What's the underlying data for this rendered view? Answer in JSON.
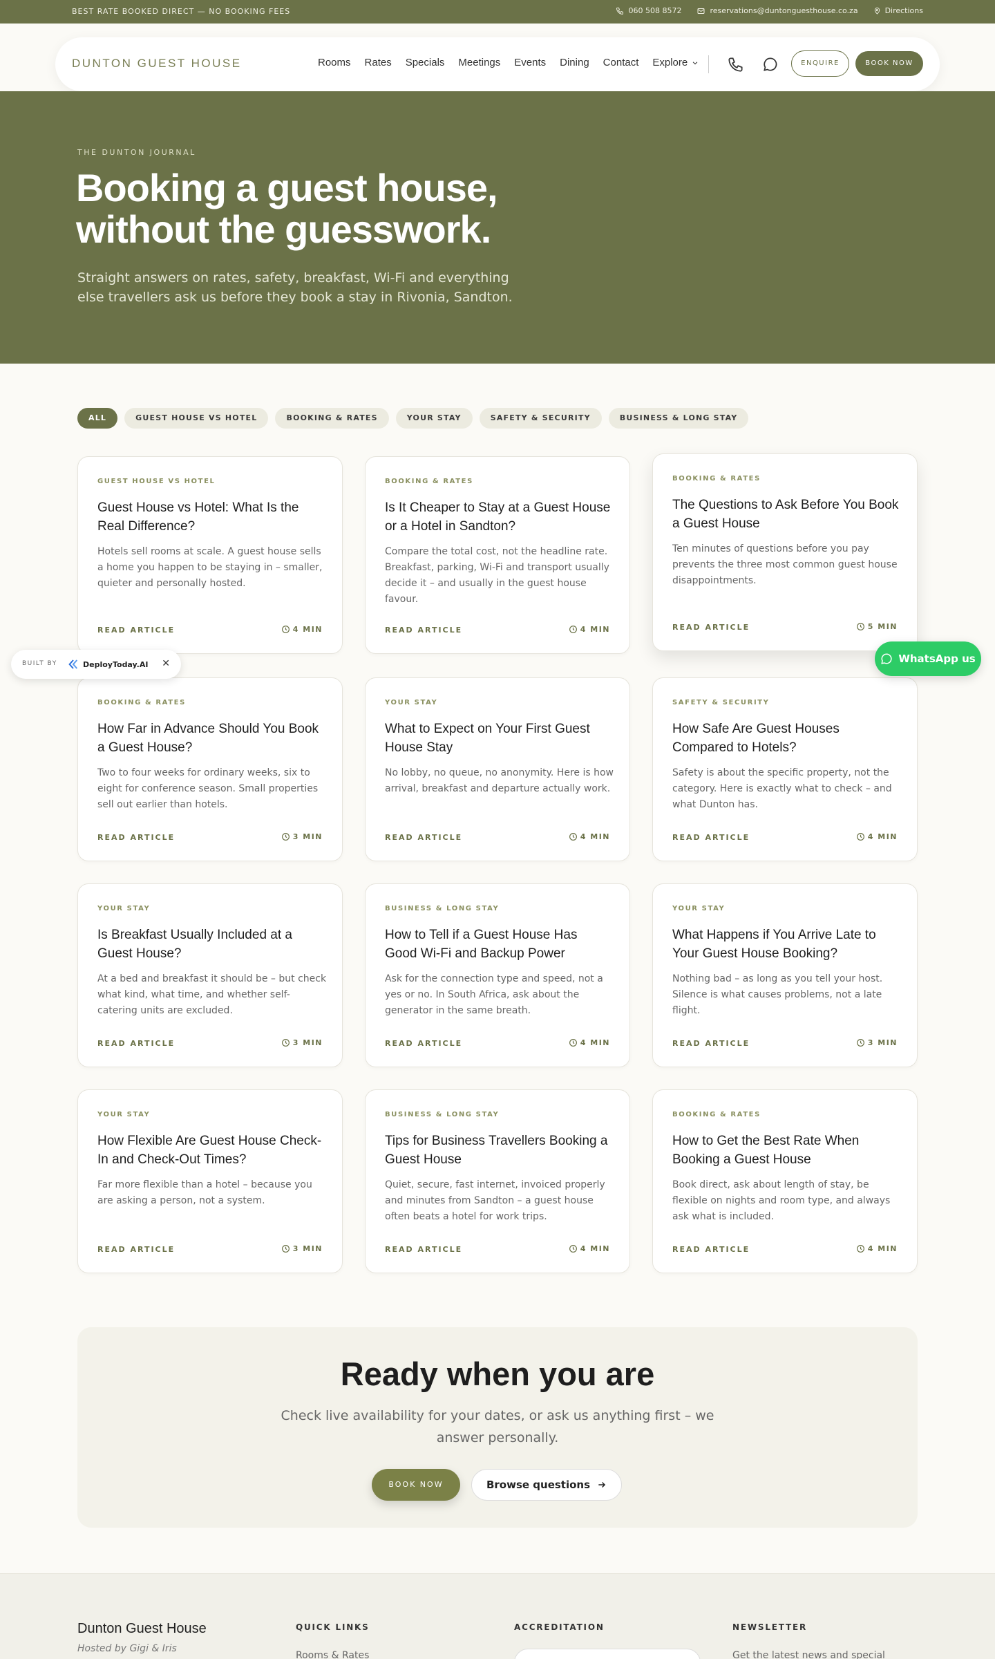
{
  "topbar": {
    "promo": "BEST RATE BOOKED DIRECT — NO BOOKING FEES",
    "phone": "060 508 8572",
    "email": "reservations@duntonguesthouse.co.za",
    "directions": "Directions"
  },
  "nav": {
    "logo": "DUNTON GUEST HOUSE",
    "items": [
      "Rooms",
      "Rates",
      "Specials",
      "Meetings",
      "Events",
      "Dining",
      "Contact",
      "Explore"
    ],
    "enquire": "ENQUIRE",
    "book": "BOOK NOW"
  },
  "hero": {
    "eyebrow": "THE DUNTON JOURNAL",
    "title": "Booking a guest house, without the guesswork.",
    "subtitle": "Straight answers on rates, safety, breakfast, Wi-Fi and everything else travellers ask us before they book a stay in Rivonia, Sandton."
  },
  "filters": [
    "ALL",
    "GUEST HOUSE VS HOTEL",
    "BOOKING & RATES",
    "YOUR STAY",
    "SAFETY & SECURITY",
    "BUSINESS & LONG STAY"
  ],
  "cards": [
    {
      "cat": "GUEST HOUSE VS HOTEL",
      "title": "Guest House vs Hotel: What Is the Real Difference?",
      "excerpt": "Hotels sell rooms at scale. A guest house sells a home you happen to be staying in – smaller, quieter and personally hosted.",
      "read": "READ ARTICLE",
      "time": "4 MIN"
    },
    {
      "cat": "BOOKING & RATES",
      "title": "Is It Cheaper to Stay at a Guest House or a Hotel in Sandton?",
      "excerpt": "Compare the total cost, not the headline rate. Breakfast, parking, Wi-Fi and transport usually decide it – and usually in the guest house favour.",
      "read": "READ ARTICLE",
      "time": "4 MIN"
    },
    {
      "cat": "BOOKING & RATES",
      "title": "The Questions to Ask Before You Book a Guest House",
      "excerpt": "Ten minutes of questions before you pay prevents the three most common guest house disappointments.",
      "read": "READ ARTICLE",
      "time": "5 MIN"
    },
    {
      "cat": "BOOKING & RATES",
      "title": "How Far in Advance Should You Book a Guest House?",
      "excerpt": "Two to four weeks for ordinary weeks, six to eight for conference season. Small properties sell out earlier than hotels.",
      "read": "READ ARTICLE",
      "time": "3 MIN"
    },
    {
      "cat": "YOUR STAY",
      "title": "What to Expect on Your First Guest House Stay",
      "excerpt": "No lobby, no queue, no anonymity. Here is how arrival, breakfast and departure actually work.",
      "read": "READ ARTICLE",
      "time": "4 MIN"
    },
    {
      "cat": "SAFETY & SECURITY",
      "title": "How Safe Are Guest Houses Compared to Hotels?",
      "excerpt": "Safety is about the specific property, not the category. Here is exactly what to check – and what Dunton has.",
      "read": "READ ARTICLE",
      "time": "4 MIN"
    },
    {
      "cat": "YOUR STAY",
      "title": "Is Breakfast Usually Included at a Guest House?",
      "excerpt": "At a bed and breakfast it should be – but check what kind, what time, and whether self-catering units are excluded.",
      "read": "READ ARTICLE",
      "time": "3 MIN"
    },
    {
      "cat": "BUSINESS & LONG STAY",
      "title": "How to Tell if a Guest House Has Good Wi-Fi and Backup Power",
      "excerpt": "Ask for the connection type and speed, not a yes or no. In South Africa, ask about the generator in the same breath.",
      "read": "READ ARTICLE",
      "time": "4 MIN"
    },
    {
      "cat": "YOUR STAY",
      "title": "What Happens if You Arrive Late to Your Guest House Booking?",
      "excerpt": "Nothing bad – as long as you tell your host. Silence is what causes problems, not a late flight.",
      "read": "READ ARTICLE",
      "time": "3 MIN"
    },
    {
      "cat": "YOUR STAY",
      "title": "How Flexible Are Guest House Check-In and Check-Out Times?",
      "excerpt": "Far more flexible than a hotel – because you are asking a person, not a system.",
      "read": "READ ARTICLE",
      "time": "3 MIN"
    },
    {
      "cat": "BUSINESS & LONG STAY",
      "title": "Tips for Business Travellers Booking a Guest House",
      "excerpt": "Quiet, secure, fast internet, invoiced properly and minutes from Sandton – a guest house often beats a hotel for work trips.",
      "read": "READ ARTICLE",
      "time": "4 MIN"
    },
    {
      "cat": "BOOKING & RATES",
      "title": "How to Get the Best Rate When Booking a Guest House",
      "excerpt": "Book direct, ask about length of stay, be flexible on nights and room type, and always ask what is included.",
      "read": "READ ARTICLE",
      "time": "4 MIN"
    }
  ],
  "badge": {
    "built_by": "BUILT BY",
    "brand": "DeployToday.AI",
    "close": "✕"
  },
  "whatsapp": "WhatsApp us",
  "cta": {
    "title": "Ready when you are",
    "text": "Check live availability for your dates, or ask us anything first – we answer personally.",
    "book": "BOOK NOW",
    "browse": "Browse questions"
  },
  "footer": {
    "name": "Dunton Guest House",
    "host": "Hosted by Gigi & Iris",
    "quick_links": "QUICK LINKS",
    "link1": "Rooms & Rates",
    "accreditation": "ACCREDITATION",
    "newsletter": "NEWSLETTER",
    "newsletter_text": "Get the latest news and special"
  },
  "colors": {
    "olive": "#6b7248",
    "whatsapp": "#2dcc66",
    "bg": "#fbfaf6"
  }
}
